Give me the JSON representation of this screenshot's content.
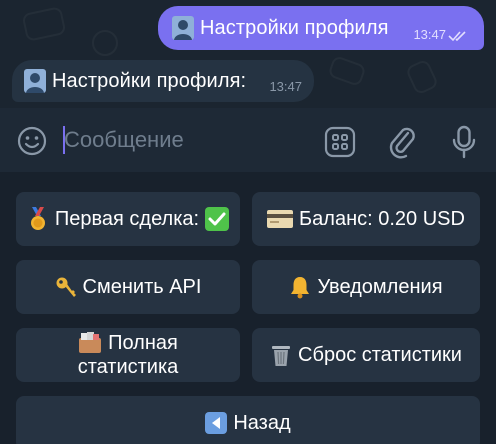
{
  "chat": {
    "outgoing": {
      "icon": "person-silhouette-icon",
      "text": "Настройки профиля",
      "time": "13:47",
      "status": "read-double-check-icon"
    },
    "incoming": {
      "icon": "person-silhouette-icon",
      "text": "Настройки профиля:",
      "time": "13:47"
    }
  },
  "input_bar": {
    "placeholder": "Сообщение",
    "value": "",
    "emoji_icon": "smile-icon",
    "apps_icon": "grid-icon",
    "attach_icon": "paperclip-icon",
    "mic_icon": "microphone-icon"
  },
  "keyboard": {
    "rows": [
      [
        {
          "icon": "medal-icon",
          "label": "Первая сделка:",
          "suffix_icon": "check-box-icon"
        },
        {
          "icon": "credit-card-icon",
          "label": "Баланс: 0.20 USD"
        }
      ],
      [
        {
          "icon": "key-icon",
          "label": "Сменить API"
        },
        {
          "icon": "bell-icon",
          "label": "Уведомления"
        }
      ],
      [
        {
          "icon": "card-box-icon",
          "label_line1": "Полная",
          "label_line2": "статистика"
        },
        {
          "icon": "trash-icon",
          "label": "Сброс статистики"
        }
      ],
      [
        {
          "icon": "back-arrow-icon",
          "label": "Назад"
        }
      ]
    ]
  },
  "colors": {
    "background": "#18212c",
    "outgoing_bubble": "#7a70f0",
    "incoming_bubble": "#253342",
    "keyboard_button": "#263342",
    "accent": "#7a70f0"
  }
}
